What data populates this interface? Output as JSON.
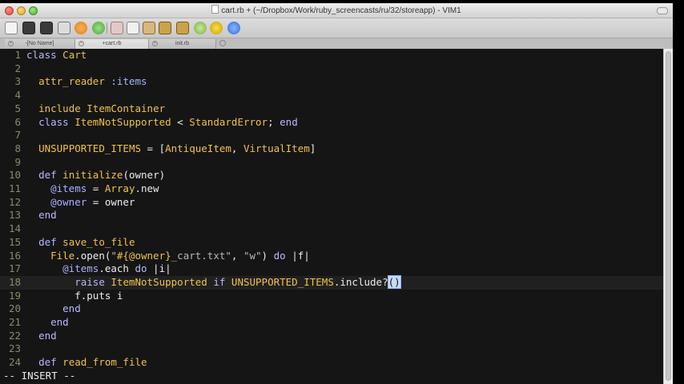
{
  "window": {
    "title": "cart.rb + (~/Dropbox/Work/ruby_screencasts/ru/32/storeapp) - VIM1"
  },
  "toolbar": {
    "icons": [
      "new-file-icon",
      "save-icon",
      "save-all-icon",
      "print-icon",
      "undo-icon",
      "redo-icon",
      "cut-icon",
      "copy-icon",
      "paste-icon",
      "find-icon",
      "find-replace-icon",
      "load-session-icon",
      "save-session-icon",
      "run-script-icon",
      "make-icon",
      "help-icon"
    ]
  },
  "tabs": [
    {
      "label": "-[No Name]",
      "active": false
    },
    {
      "label": "+cart.rb",
      "active": true
    },
    {
      "label": "init.rb",
      "active": false
    }
  ],
  "editor": {
    "mode": "-- INSERT --",
    "lines": [
      {
        "n": "1"
      },
      {
        "n": "2"
      },
      {
        "n": "3"
      },
      {
        "n": "4"
      },
      {
        "n": "5"
      },
      {
        "n": "6"
      },
      {
        "n": "7"
      },
      {
        "n": "8"
      },
      {
        "n": "9"
      },
      {
        "n": "10"
      },
      {
        "n": "11"
      },
      {
        "n": "12"
      },
      {
        "n": "13"
      },
      {
        "n": "14"
      },
      {
        "n": "15"
      },
      {
        "n": "16"
      },
      {
        "n": "17"
      },
      {
        "n": "18"
      },
      {
        "n": "19"
      },
      {
        "n": "20"
      },
      {
        "n": "21"
      },
      {
        "n": "22"
      },
      {
        "n": "23"
      },
      {
        "n": "24"
      }
    ],
    "code": {
      "l1": {
        "kw": "class",
        "name": "Cart"
      },
      "l3": {
        "call": "attr_reader",
        "sym": ":items"
      },
      "l5": {
        "call": "include",
        "const": "ItemContainer"
      },
      "l6": {
        "kw": "class",
        "const1": "ItemNotSupported",
        "op": " < ",
        "const2": "StandardError",
        "semi": "; ",
        "end": "end"
      },
      "l8": {
        "const": "UNSUPPORTED_ITEMS",
        "op": " = [",
        "c1": "AntiqueItem",
        "comma": ", ",
        "c2": "VirtualItem",
        "close": "]"
      },
      "l10": {
        "kw": "def",
        "name": "initialize",
        "args": "(owner)"
      },
      "l11": {
        "ivar": "@items",
        "op": " = ",
        "const": "Array",
        "call": ".new"
      },
      "l12": {
        "ivar": "@owner",
        "op": " = ",
        "val": "owner"
      },
      "l13": {
        "kw": "end"
      },
      "l15": {
        "kw": "def",
        "name": "save_to_file"
      },
      "l16": {
        "const": "File",
        "call": ".open(",
        "q1": "\"",
        "interp": "#{@owner}",
        "s1": "_cart.txt",
        "q2": "\"",
        "comma": ", ",
        "s2": "\"w\"",
        "close": ") ",
        "do": "do",
        "blk": " |f|"
      },
      "l17": {
        "ivar": "@items",
        "call": ".each ",
        "do": "do",
        "blk": " |i|"
      },
      "l18": {
        "kw": "raise",
        "const1": "ItemNotSupported",
        "kw2": " if ",
        "const2": "UNSUPPORTED_ITEMS",
        "call": ".include?",
        "cursor": "()"
      },
      "l19": {
        "call": "f.puts i"
      },
      "l20": {
        "kw": "end"
      },
      "l21": {
        "kw": "end"
      },
      "l22": {
        "kw": "end"
      },
      "l24": {
        "kw": "def",
        "name": "read_from_file"
      }
    }
  }
}
